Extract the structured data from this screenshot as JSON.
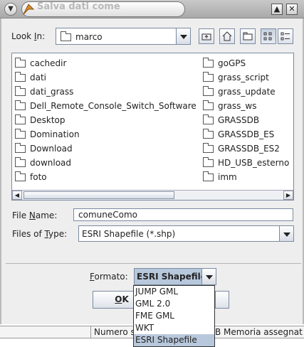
{
  "window": {
    "title": "Salva dati come"
  },
  "look_in": {
    "label_pre": "Look ",
    "label_key": "I",
    "label_post": "n:",
    "value": "marco"
  },
  "toolbar": {
    "icons": [
      "up-folder-icon",
      "home-icon",
      "new-folder-icon",
      "list-view-icon",
      "details-view-icon"
    ]
  },
  "files": {
    "left": [
      "cachedir",
      "dati",
      "dati_grass",
      "Dell_Remote_Console_Switch_Software",
      "Desktop",
      "Domination",
      "Download",
      "download",
      "foto"
    ],
    "right": [
      "goGPS",
      "grass_script",
      "grass_update",
      "grass_ws",
      "GRASSDB",
      "GRASSDB_ES",
      "GRASSDB_ES2",
      "HD_USB_esterno",
      "imm"
    ]
  },
  "file_name": {
    "label_pre": "File ",
    "label_key": "N",
    "label_post": "ame:",
    "value": "comuneComo"
  },
  "file_type": {
    "label_pre": "Files of ",
    "label_key": "T",
    "label_post": "ype:",
    "value": "ESRI Shapefile (*.shp)"
  },
  "formato": {
    "label_key": "F",
    "label_post": "ormato:",
    "value": "ESRI Shapefile",
    "options": [
      "JUMP GML",
      "GML 2.0",
      "FME GML",
      "WKT",
      "ESRI Shapefile"
    ],
    "selected_index": 4
  },
  "buttons": {
    "ok_key": "O",
    "ok_post": "K"
  },
  "status": {
    "cell1": "Numero s",
    "cell2": "B Memoria assegnat"
  },
  "colors": {
    "selection": "#b8c8dc",
    "border": "#7a8aa0"
  }
}
